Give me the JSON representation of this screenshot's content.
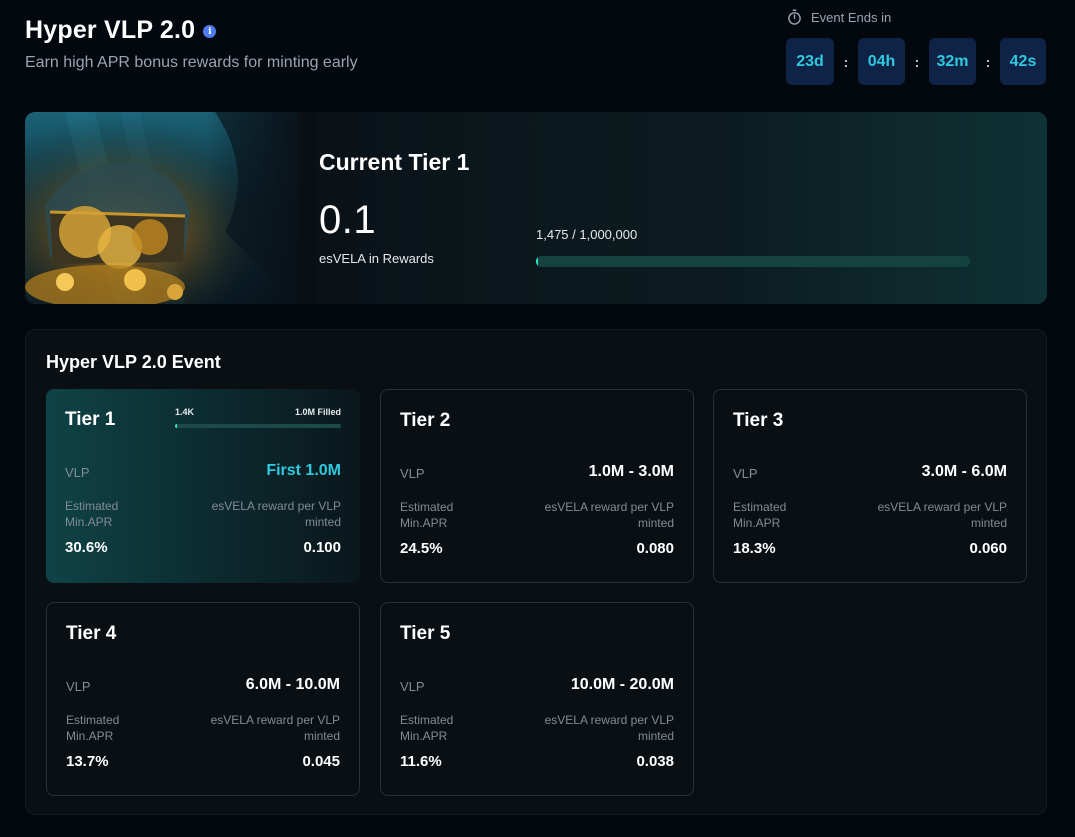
{
  "header": {
    "title": "Hyper VLP 2.0",
    "info_icon": "info-icon",
    "subtitle": "Earn high APR bonus rewards for minting early"
  },
  "timer": {
    "label": "Event Ends in",
    "icon": "stopwatch-icon",
    "days": "23d",
    "hours": "04h",
    "minutes": "32m",
    "seconds": "42s",
    "separator": ":"
  },
  "current_tier": {
    "heading": "Current Tier 1",
    "reward_value": "0.1",
    "reward_label": "esVELA in Rewards",
    "progress_text": "1,475 / 1,000,000",
    "progress_fraction": 0.001475
  },
  "event": {
    "title": "Hyper VLP 2.0 Event",
    "vlp_label": "VLP",
    "apr_label": "Estimated Min.APR",
    "reward_per_label": "esVELA reward per VLP minted",
    "tiers": [
      {
        "name": "Tier 1",
        "range": "First 1.0M",
        "apr": "30.6%",
        "reward": "0.100",
        "active": true,
        "mini_left": "1.4K",
        "mini_right": "1.0M Filled",
        "mini_fraction": 0.0014
      },
      {
        "name": "Tier 2",
        "range": "1.0M - 3.0M",
        "apr": "24.5%",
        "reward": "0.080"
      },
      {
        "name": "Tier 3",
        "range": "3.0M - 6.0M",
        "apr": "18.3%",
        "reward": "0.060"
      },
      {
        "name": "Tier 4",
        "range": "6.0M - 10.0M",
        "apr": "13.7%",
        "reward": "0.045"
      },
      {
        "name": "Tier 5",
        "range": "10.0M - 20.0M",
        "apr": "11.6%",
        "reward": "0.038"
      }
    ]
  },
  "colors": {
    "accent_cyan": "#2fc9e0",
    "progress_teal": "#2ee6c9",
    "timer_box": "#0f2346",
    "info_blue": "#4f7bf2"
  }
}
